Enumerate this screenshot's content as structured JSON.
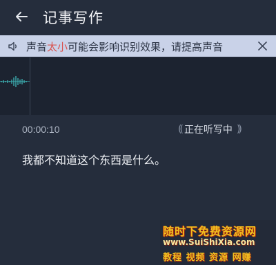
{
  "header": {
    "title": "记事写作",
    "back_icon": "arrow-left-icon"
  },
  "notice": {
    "text_before": "声音",
    "text_highlight": "太小",
    "text_after": "可能会影响识别效果，请提高声音",
    "highlight_color": "#d9534f",
    "speaker_icon": "speaker-icon",
    "close_icon": "close-icon"
  },
  "recording": {
    "elapsed": "00:00:10",
    "status_label": "正在听写中"
  },
  "transcript": {
    "text": "我都不知道这个东西是什么。"
  },
  "watermark": {
    "line1": "随时下免费资源网",
    "line2": "www.SuiShiXia.com",
    "line3": "教程 视频 资源 网赚"
  },
  "colors": {
    "background": "#252d3c",
    "notice_bg": "#c9d2e8",
    "wave": "#3fb5b8"
  }
}
